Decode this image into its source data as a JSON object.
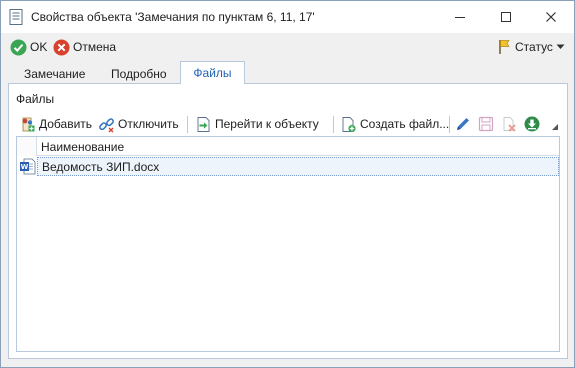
{
  "window": {
    "title": "Свойства объекта 'Замечания по пунктам 6, 11, 17'",
    "icons": {
      "app": "document-icon",
      "minimize": "minimize-icon",
      "maximize": "maximize-icon",
      "close": "close-icon"
    }
  },
  "commands": {
    "ok_label": "OK",
    "cancel_label": "Отмена",
    "status_label": "Статус"
  },
  "tabs": [
    {
      "label": "Замечание",
      "active": false
    },
    {
      "label": "Подробно",
      "active": false
    },
    {
      "label": "Файлы",
      "active": true
    }
  ],
  "files_panel": {
    "group_title": "Файлы",
    "toolbar": {
      "add_label": "Добавить",
      "detach_label": "Отключить",
      "goto_label": "Перейти к объекту",
      "create_label": "Создать файл...",
      "icon_buttons": [
        "edit-icon",
        "save-icon",
        "delete-icon",
        "download-icon"
      ]
    },
    "grid": {
      "columns": [
        "Наименование"
      ],
      "rows": [
        {
          "icon": "word-document-icon",
          "name": "Ведомость ЗИП.docx",
          "selected": true
        }
      ]
    }
  },
  "colors": {
    "accent": "#1e63b6",
    "ok_green": "#3aa655",
    "cancel_red": "#d9412f",
    "selection": "#eef4fb"
  }
}
